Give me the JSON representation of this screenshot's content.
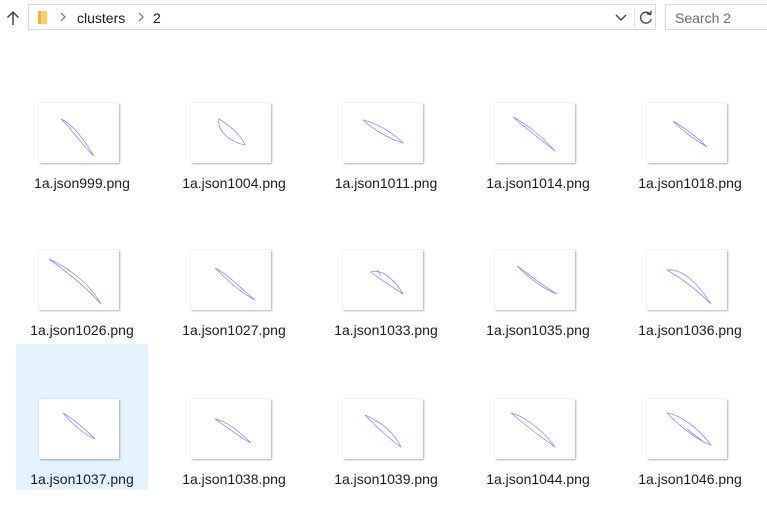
{
  "toolbar": {
    "up_icon": "up-arrow-icon"
  },
  "address_bar": {
    "folder_icon": "folder-icon",
    "breadcrumb": [
      "clusters",
      "2"
    ],
    "dropdown_icon": "chevron-down-icon",
    "refresh_icon": "refresh-icon"
  },
  "search": {
    "placeholder": "Search 2"
  },
  "files": [
    {
      "name": "1a.json999.png"
    },
    {
      "name": "1a.json1004.png"
    },
    {
      "name": "1a.json1011.png"
    },
    {
      "name": "1a.json1014.png"
    },
    {
      "name": "1a.json1018.png"
    },
    {
      "name": "1a.json1026.png"
    },
    {
      "name": "1a.json1027.png"
    },
    {
      "name": "1a.json1033.png"
    },
    {
      "name": "1a.json1035.png"
    },
    {
      "name": "1a.json1036.png"
    },
    {
      "name": "1a.json1037.png",
      "selected": true
    },
    {
      "name": "1a.json1038.png"
    },
    {
      "name": "1a.json1039.png"
    },
    {
      "name": "1a.json1044.png"
    },
    {
      "name": "1a.json1046.png"
    }
  ],
  "colors": {
    "selection": "#e5f3ff",
    "stroke": "#8c8ce8"
  }
}
